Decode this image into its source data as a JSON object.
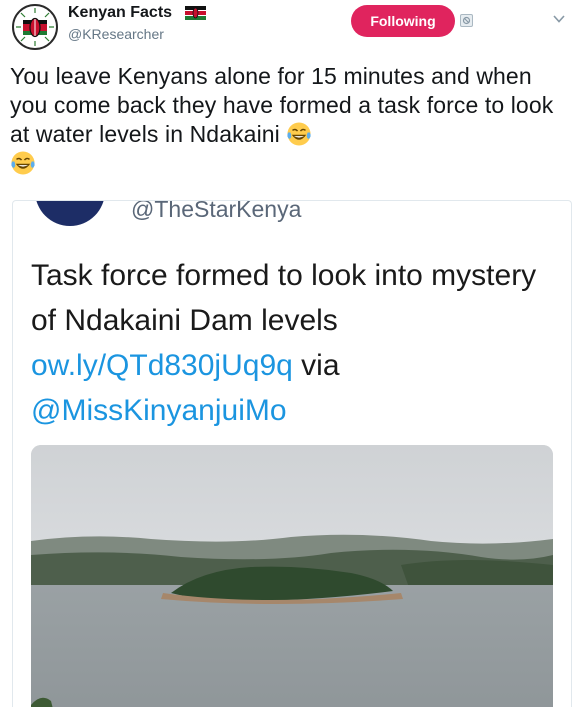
{
  "author": {
    "display_name": "Kenyan Facts",
    "handle": "@KResearcher",
    "flag_icon": "kenya-flag-icon"
  },
  "actions": {
    "follow_label": "Following"
  },
  "tweet": {
    "text": "You leave Kenyans alone for 15 minutes and when you come back they have formed a task force to look at water levels in Ndakaini",
    "emoji": "tears-of-joy"
  },
  "quoted": {
    "handle": "@TheStarKenya",
    "text_prefix": "Task force formed to look into mystery of Ndakaini Dam levels ",
    "link": "ow.ly/QTd830jUq9q",
    "via": " via ",
    "mention": "@MissKinyanjuiMo"
  },
  "colors": {
    "follow_button": "#e0245e",
    "link": "#1b95e0",
    "muted": "#657786"
  }
}
